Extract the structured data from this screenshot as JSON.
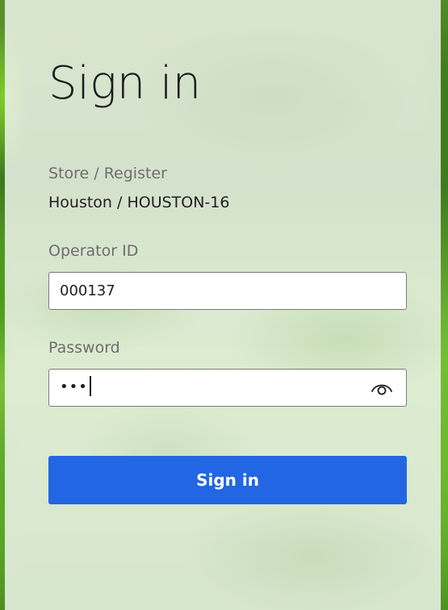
{
  "page": {
    "title": "Sign in"
  },
  "store_register": {
    "label": "Store / Register",
    "value": "Houston / HOUSTON-16"
  },
  "operator_id": {
    "label": "Operator ID",
    "value": "000137"
  },
  "password": {
    "label": "Password",
    "masked_value": "•••",
    "reveal_icon": "eye-icon"
  },
  "sign_in_button": {
    "label": "Sign in"
  },
  "colors": {
    "accent": "#2266e3",
    "panel": "#eef3ea",
    "label_text": "#6e6e6e"
  }
}
